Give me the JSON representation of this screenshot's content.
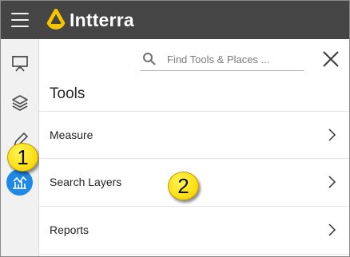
{
  "header": {
    "brand": "Intterra",
    "menu_icon": "hamburger-icon",
    "logo_icon": "intterra-logo",
    "bg_color": "#454545",
    "logo_color": "#f6c500"
  },
  "rail": {
    "items": [
      {
        "icon": "presentation-icon"
      },
      {
        "icon": "layers-icon"
      },
      {
        "icon": "pencil-icon"
      },
      {
        "icon": "tools-chart-icon",
        "active": true
      }
    ],
    "active_color": "#1e88e5"
  },
  "callouts": [
    "1",
    "2"
  ],
  "panel": {
    "search": {
      "placeholder": "Find Tools & Places ..."
    },
    "close_icon": "close-icon",
    "title": "Tools",
    "items": [
      {
        "label": "Measure"
      },
      {
        "label": "Search Layers"
      },
      {
        "label": "Reports"
      }
    ]
  }
}
